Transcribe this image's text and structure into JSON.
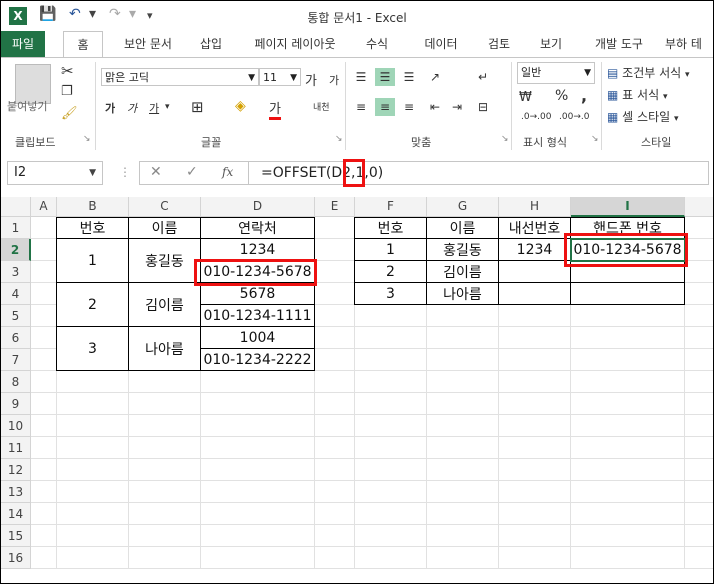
{
  "window": {
    "title": "통합 문서1 - Excel",
    "app_icon": "X"
  },
  "quick_access": {
    "save_icon": "💾",
    "undo_icon": "↶",
    "redo_icon": "↷",
    "customize_icon": "▾"
  },
  "tabs": [
    "파일",
    "홈",
    "보안 문서",
    "삽입",
    "페이지 레이아웃",
    "수식",
    "데이터",
    "검토",
    "보기",
    "개발 도구",
    "부하 테"
  ],
  "ribbon": {
    "clipboard": {
      "paste": "붙여넣기",
      "label": "클립보드"
    },
    "font": {
      "name": "맑은 고딕",
      "size": "11",
      "grow": "가",
      "shrink": "가",
      "bold": "가",
      "italic": "가",
      "underline": "가",
      "border_icon": "⊞",
      "fill_icon": "◈",
      "color_sample": "가",
      "phonetic": "내천",
      "label": "글꼴"
    },
    "alignment": {
      "label": "맞춤"
    },
    "number": {
      "format": "일반",
      "percent": "%",
      "comma": ",",
      "label": "표시 형식"
    },
    "styles": {
      "conditional": "조건부 서식",
      "table": "표 서식",
      "cell": "셀 스타일",
      "label": "스타일"
    }
  },
  "formula_bar": {
    "name_box": "I2",
    "cancel": "✕",
    "enter": "✓",
    "fx": "fx",
    "formula": "=OFFSET(D2,1,0)"
  },
  "columns": [
    "A",
    "B",
    "C",
    "D",
    "E",
    "F",
    "G",
    "H",
    "I"
  ],
  "rows": [
    "1",
    "2",
    "3",
    "4",
    "5",
    "6",
    "7",
    "8",
    "9",
    "10",
    "11",
    "12",
    "13",
    "14",
    "15",
    "16"
  ],
  "table1": {
    "headers": [
      "번호",
      "이름",
      "연락처"
    ],
    "entries": [
      {
        "num": "1",
        "name": "홍길동",
        "ext": "1234",
        "phone": "010-1234-5678"
      },
      {
        "num": "2",
        "name": "김이름",
        "ext": "5678",
        "phone": "010-1234-1111"
      },
      {
        "num": "3",
        "name": "나아름",
        "ext": "1004",
        "phone": "010-1234-2222"
      }
    ]
  },
  "table2": {
    "headers": [
      "번호",
      "이름",
      "내선번호",
      "핸드폰 번호"
    ],
    "rows": [
      {
        "num": "1",
        "name": "홍길동",
        "ext": "1234",
        "phone": "010-1234-5678"
      },
      {
        "num": "2",
        "name": "김이름",
        "ext": "",
        "phone": ""
      },
      {
        "num": "3",
        "name": "나아름",
        "ext": "",
        "phone": ""
      }
    ]
  },
  "colors": {
    "excel_green": "#217346",
    "highlight_red": "#e11111",
    "selected_align": "#9fd5b7"
  }
}
